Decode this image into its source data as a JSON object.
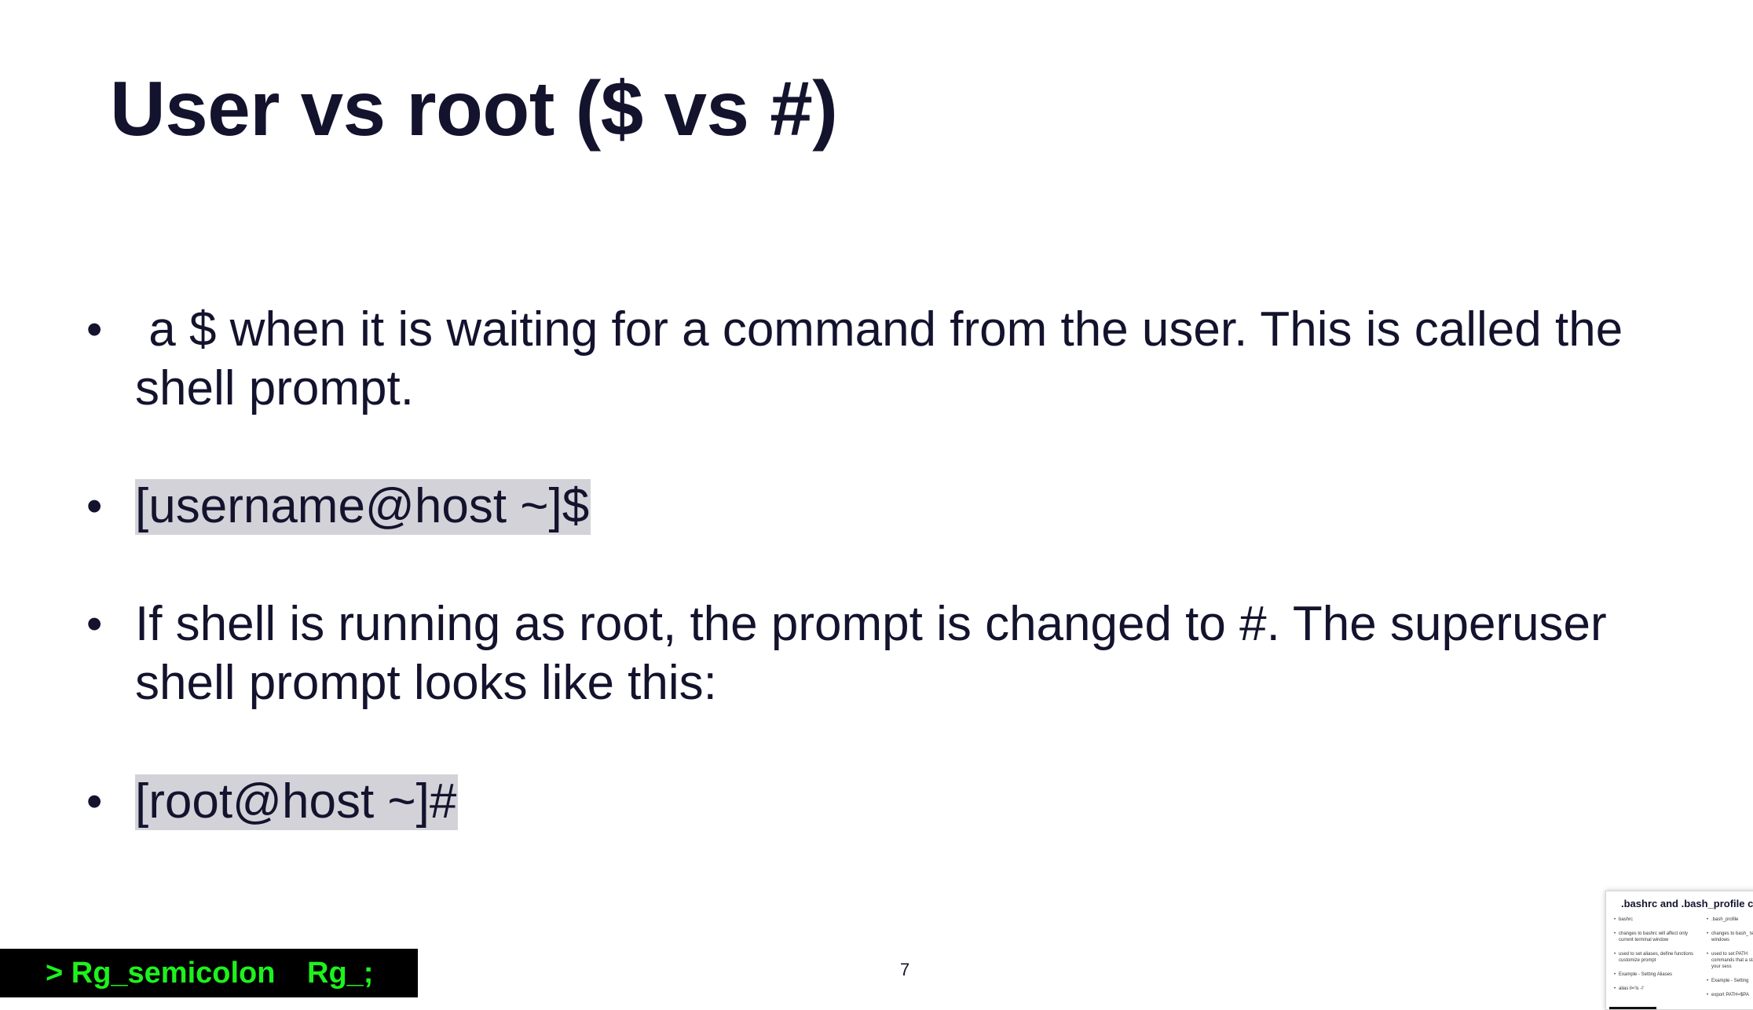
{
  "slide": {
    "title": "User vs root ($ vs #)",
    "bullets": [
      {
        "text": " a $ when it is waiting for a command from the user. This is called the shell prompt.",
        "highlight": false
      },
      {
        "text": "[username@host ~]$",
        "highlight": true
      },
      {
        "text": "If shell is running as root, the prompt is changed to #. The superuser shell prompt looks like this:",
        "highlight": false
      },
      {
        "text": "[root@host ~]#",
        "highlight": true
      }
    ],
    "bullet_symbol": "•",
    "page_number": "7"
  },
  "status_bar": {
    "command": "> Rg_semicolon",
    "shortcut": "Rg_;",
    "text_color": "#1df21d",
    "background_color": "#000000"
  },
  "next_slide_thumbnail": {
    "title": ".bashrc  and .bash_profile con",
    "left_items": [
      "bashrc",
      "changes to bashrc will affect only current terminal window",
      "used to set aliases, define functions customize prompt",
      "Example - Setting Aliases",
      "alias ll='ls -l'"
    ],
    "right_items": [
      ".bash_profile",
      "changes to bash_ terminal windows",
      "used to set PATH commands that a start of your sess",
      "Example - Setting",
      "export PATH=$PA"
    ]
  },
  "colors": {
    "text": "#13132e",
    "highlight": "#d3d2d8",
    "background": "#ffffff"
  }
}
